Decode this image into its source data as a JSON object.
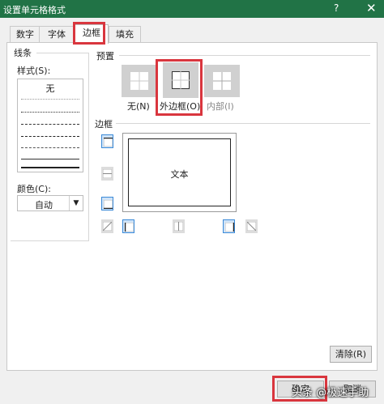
{
  "window": {
    "title": "设置单元格格式",
    "help": "?",
    "close": "✕"
  },
  "tabs": [
    {
      "label": "数字"
    },
    {
      "label": "字体"
    },
    {
      "label": "边框"
    },
    {
      "label": "填充"
    }
  ],
  "line_group": {
    "title": "线条",
    "style_label": "样式(S):",
    "none_label": "无",
    "color_label": "颜色(C):",
    "color_value": "自动"
  },
  "presets": {
    "title": "预置",
    "items": [
      {
        "label": "无(N)",
        "icon": "border-none-icon"
      },
      {
        "label": "外边框(O)",
        "icon": "border-outline-icon"
      },
      {
        "label": "内部(I)",
        "icon": "border-inside-icon"
      }
    ]
  },
  "border": {
    "title": "边框",
    "preview_text": "文本"
  },
  "buttons": {
    "clear": "清除(R)",
    "ok": "确定",
    "cancel": "取消"
  },
  "watermark": "头条 @极速手助",
  "colors": {
    "titlebar": "#217346",
    "highlight": "#d9363e",
    "accent": "#3b8ad8"
  }
}
